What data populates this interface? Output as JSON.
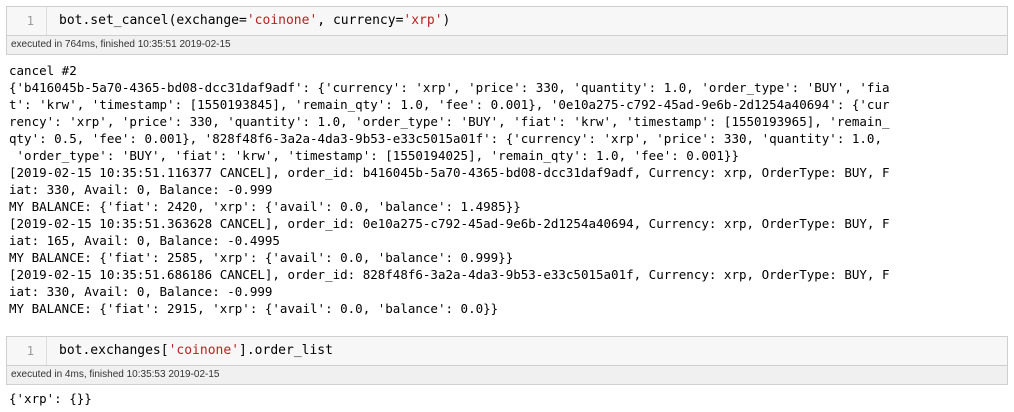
{
  "cell1": {
    "line_number": "1",
    "code": {
      "p1": "bot.set_cancel(exchange=",
      "s1": "'coinone'",
      "p2": ", currency=",
      "s2": "'xrp'",
      "p3": ")"
    },
    "status": "executed in 764ms, finished 10:35:51 2019-02-15",
    "output": [
      "cancel #2",
      "{'b416045b-5a70-4365-bd08-dcc31daf9adf': {'currency': 'xrp', 'price': 330, 'quantity': 1.0, 'order_type': 'BUY', 'fia",
      "t': 'krw', 'timestamp': [1550193845], 'remain_qty': 1.0, 'fee': 0.001}, '0e10a275-c792-45ad-9e6b-2d1254a40694': {'cur",
      "rency': 'xrp', 'price': 330, 'quantity': 1.0, 'order_type': 'BUY', 'fiat': 'krw', 'timestamp': [1550193965], 'remain_",
      "qty': 0.5, 'fee': 0.001}, '828f48f6-3a2a-4da3-9b53-e33c5015a01f': {'currency': 'xrp', 'price': 330, 'quantity': 1.0,",
      " 'order_type': 'BUY', 'fiat': 'krw', 'timestamp': [1550194025], 'remain_qty': 1.0, 'fee': 0.001}}",
      "[2019-02-15 10:35:51.116377 CANCEL], order_id: b416045b-5a70-4365-bd08-dcc31daf9adf, Currency: xrp, OrderType: BUY, F",
      "iat: 330, Avail: 0, Balance: -0.999",
      "MY BALANCE: {'fiat': 2420, 'xrp': {'avail': 0.0, 'balance': 1.4985}}",
      "[2019-02-15 10:35:51.363628 CANCEL], order_id: 0e10a275-c792-45ad-9e6b-2d1254a40694, Currency: xrp, OrderType: BUY, F",
      "iat: 165, Avail: 0, Balance: -0.4995",
      "MY BALANCE: {'fiat': 2585, 'xrp': {'avail': 0.0, 'balance': 0.999}}",
      "[2019-02-15 10:35:51.686186 CANCEL], order_id: 828f48f6-3a2a-4da3-9b53-e33c5015a01f, Currency: xrp, OrderType: BUY, F",
      "iat: 330, Avail: 0, Balance: -0.999",
      "MY BALANCE: {'fiat': 2915, 'xrp': {'avail': 0.0, 'balance': 0.0}}"
    ]
  },
  "cell2": {
    "line_number": "1",
    "code": {
      "p1": "bot.exchanges[",
      "s1": "'coinone'",
      "p2": "].order_list"
    },
    "status": "executed in 4ms, finished 10:35:53 2019-02-15",
    "output": [
      "{'xrp': {}}"
    ]
  },
  "colors": {
    "string": "#ba2121",
    "input_bg": "#f7f7f7",
    "status_bg": "#f0f0f0",
    "border": "#cfcfcf"
  }
}
